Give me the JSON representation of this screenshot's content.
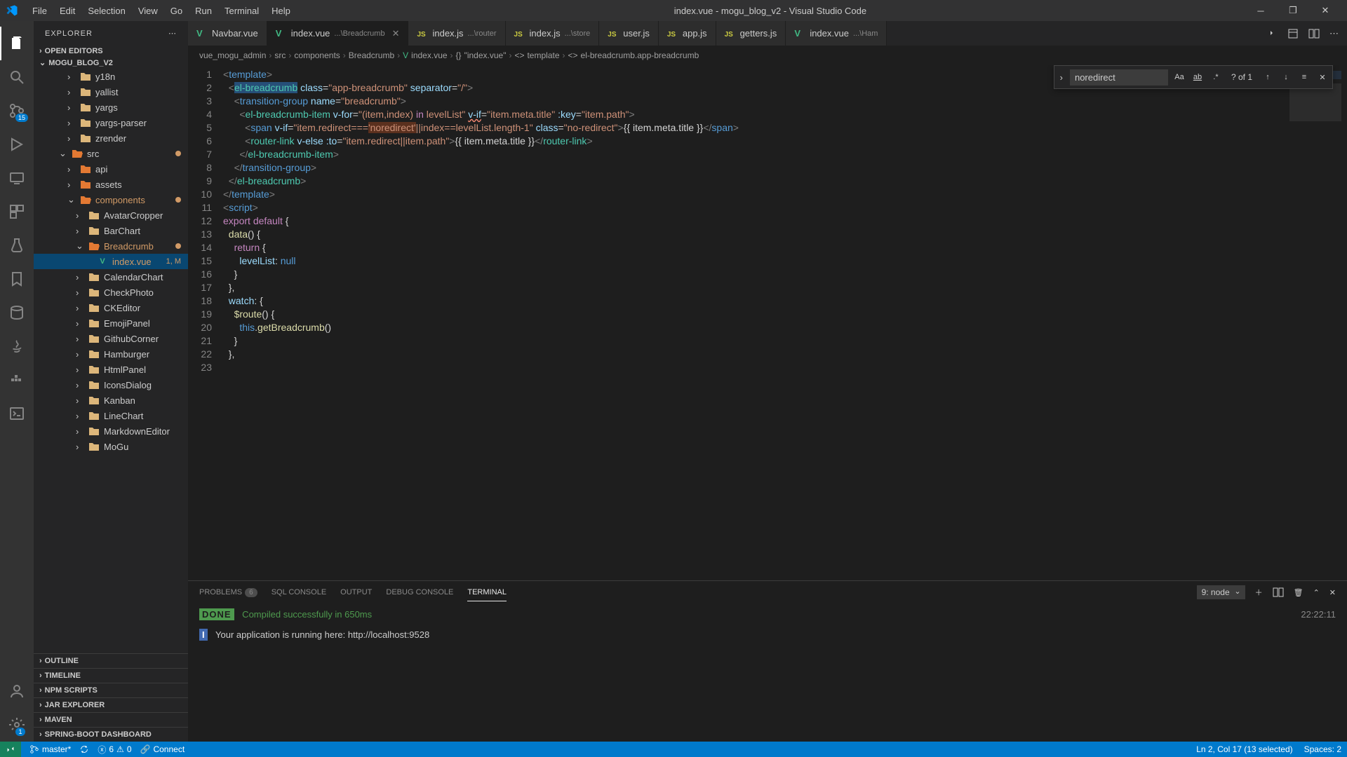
{
  "window": {
    "title": "index.vue - mogu_blog_v2 - Visual Studio Code"
  },
  "menu": [
    "File",
    "Edit",
    "Selection",
    "View",
    "Go",
    "Run",
    "Terminal",
    "Help"
  ],
  "activity": {
    "source_badge": "15",
    "settings_badge": "1"
  },
  "explorer": {
    "title": "EXPLORER",
    "open_editors": "OPEN EDITORS",
    "project": "MOGU_BLOG_V2",
    "tree": [
      {
        "indent": 2,
        "chevron": "›",
        "icon": "folder",
        "label": "y18n",
        "color": "folder-yellow"
      },
      {
        "indent": 2,
        "chevron": "›",
        "icon": "folder",
        "label": "yallist",
        "color": "folder-yellow"
      },
      {
        "indent": 2,
        "chevron": "›",
        "icon": "folder",
        "label": "yargs",
        "color": "folder-yellow"
      },
      {
        "indent": 2,
        "chevron": "›",
        "icon": "folder",
        "label": "yargs-parser",
        "color": "folder-yellow"
      },
      {
        "indent": 2,
        "chevron": "›",
        "icon": "folder",
        "label": "zrender",
        "color": "folder-yellow"
      },
      {
        "indent": 1,
        "chevron": "⌄",
        "icon": "folder-open",
        "label": "src",
        "color": "folder-orange",
        "dot": true
      },
      {
        "indent": 2,
        "chevron": "›",
        "icon": "folder",
        "label": "api",
        "color": "folder-orange"
      },
      {
        "indent": 2,
        "chevron": "›",
        "icon": "folder",
        "label": "assets",
        "color": "folder-orange"
      },
      {
        "indent": 2,
        "chevron": "⌄",
        "icon": "folder-open",
        "label": "components",
        "color": "folder-orange",
        "mod": true,
        "dot": true
      },
      {
        "indent": 3,
        "chevron": "›",
        "icon": "folder",
        "label": "AvatarCropper",
        "color": "folder-yellow"
      },
      {
        "indent": 3,
        "chevron": "›",
        "icon": "folder",
        "label": "BarChart",
        "color": "folder-yellow"
      },
      {
        "indent": 3,
        "chevron": "⌄",
        "icon": "folder-open",
        "label": "Breadcrumb",
        "color": "folder-orange",
        "mod": true,
        "dot": true
      },
      {
        "indent": 4,
        "chevron": "",
        "icon": "vue",
        "label": "index.vue",
        "color": "file-green",
        "active": true,
        "mod": true,
        "decoration": "1, M"
      },
      {
        "indent": 3,
        "chevron": "›",
        "icon": "folder",
        "label": "CalendarChart",
        "color": "folder-yellow"
      },
      {
        "indent": 3,
        "chevron": "›",
        "icon": "folder",
        "label": "CheckPhoto",
        "color": "folder-yellow"
      },
      {
        "indent": 3,
        "chevron": "›",
        "icon": "folder",
        "label": "CKEditor",
        "color": "folder-yellow"
      },
      {
        "indent": 3,
        "chevron": "›",
        "icon": "folder",
        "label": "EmojiPanel",
        "color": "folder-yellow"
      },
      {
        "indent": 3,
        "chevron": "›",
        "icon": "folder",
        "label": "GithubCorner",
        "color": "folder-yellow"
      },
      {
        "indent": 3,
        "chevron": "›",
        "icon": "folder",
        "label": "Hamburger",
        "color": "folder-yellow"
      },
      {
        "indent": 3,
        "chevron": "›",
        "icon": "folder",
        "label": "HtmlPanel",
        "color": "folder-yellow"
      },
      {
        "indent": 3,
        "chevron": "›",
        "icon": "folder",
        "label": "IconsDialog",
        "color": "folder-yellow"
      },
      {
        "indent": 3,
        "chevron": "›",
        "icon": "folder",
        "label": "Kanban",
        "color": "folder-yellow"
      },
      {
        "indent": 3,
        "chevron": "›",
        "icon": "folder",
        "label": "LineChart",
        "color": "folder-yellow"
      },
      {
        "indent": 3,
        "chevron": "›",
        "icon": "folder",
        "label": "MarkdownEditor",
        "color": "folder-yellow"
      },
      {
        "indent": 3,
        "chevron": "›",
        "icon": "folder",
        "label": "MoGu",
        "color": "folder-yellow"
      }
    ],
    "sections": [
      "OUTLINE",
      "TIMELINE",
      "NPM SCRIPTS",
      "JAR EXPLORER",
      "MAVEN",
      "SPRING-BOOT DASHBOARD"
    ]
  },
  "tabs": [
    {
      "icon": "vue",
      "name": "Navbar.vue",
      "path": "",
      "active": false
    },
    {
      "icon": "vue",
      "name": "index.vue",
      "path": "...\\Breadcrumb",
      "active": true,
      "close": true
    },
    {
      "icon": "js",
      "name": "index.js",
      "path": "...\\router",
      "active": false
    },
    {
      "icon": "js",
      "name": "index.js",
      "path": "...\\store",
      "active": false
    },
    {
      "icon": "js",
      "name": "user.js",
      "path": "",
      "active": false
    },
    {
      "icon": "js",
      "name": "app.js",
      "path": "",
      "active": false
    },
    {
      "icon": "js",
      "name": "getters.js",
      "path": "",
      "active": false
    },
    {
      "icon": "vue",
      "name": "index.vue",
      "path": "...\\Ham",
      "active": false
    }
  ],
  "breadcrumbs": [
    "vue_mogu_admin",
    "src",
    "components",
    "Breadcrumb",
    "index.vue",
    "\"index.vue\"",
    "template",
    "el-breadcrumb.app-breadcrumb"
  ],
  "find": {
    "value": "noredirect",
    "count": "? of 1"
  },
  "code": {
    "lines": [
      1,
      2,
      3,
      4,
      5,
      6,
      7,
      8,
      9,
      10,
      11,
      12,
      13,
      14,
      15,
      16,
      17,
      18,
      19,
      20,
      21,
      22,
      23
    ]
  },
  "panel": {
    "tabs": [
      "PROBLEMS",
      "SQL CONSOLE",
      "OUTPUT",
      "DEBUG CONSOLE",
      "TERMINAL"
    ],
    "problems_badge": "6",
    "active": 4,
    "terminal_select": "9: node",
    "line1_tag": "DONE",
    "line1": " Compiled successfully in 650ms",
    "line2_tag": "I",
    "line2": " Your application is running here: http://localhost:9528",
    "time": "22:22:11"
  },
  "status": {
    "branch": "master*",
    "sync": "",
    "errors": "6",
    "warnings": "0",
    "connect": "Connect",
    "pos": "Ln 2, Col 17 (13 selected)",
    "spaces": "Spaces: 2"
  }
}
